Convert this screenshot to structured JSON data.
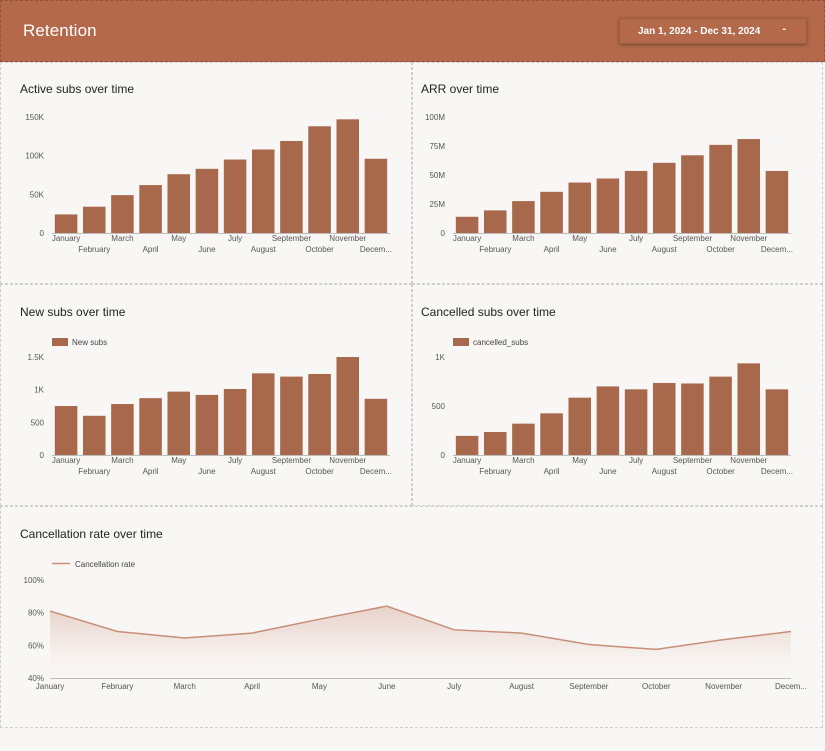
{
  "header": {
    "title": "Retention",
    "date_range": "Jan 1, 2024 - Dec 31, 2024",
    "caret": "-"
  },
  "colors": {
    "accent": "#b3694a",
    "bar": "#a8684b",
    "line": "#c98e78"
  },
  "chart_data": [
    {
      "type": "bar",
      "title": "Active subs over time",
      "categories": [
        "January",
        "February",
        "March",
        "April",
        "May",
        "June",
        "July",
        "August",
        "September",
        "October",
        "November",
        "Decem..."
      ],
      "values": [
        24000,
        34000,
        49000,
        62000,
        76000,
        83000,
        95000,
        108000,
        119000,
        138000,
        147000,
        96000
      ],
      "ylim": [
        0,
        150000
      ],
      "yticks": [
        0,
        50000,
        100000,
        150000
      ],
      "ytick_labels": [
        "0",
        "50K",
        "100K",
        "150K"
      ],
      "grid": false
    },
    {
      "type": "bar",
      "title": "ARR over time",
      "categories": [
        "January",
        "February",
        "March",
        "April",
        "May",
        "June",
        "July",
        "August",
        "September",
        "October",
        "November",
        "Decem..."
      ],
      "values": [
        14000000,
        19500000,
        27500000,
        35500000,
        43500000,
        47000000,
        53500000,
        60500000,
        67000000,
        76000000,
        81000000,
        53500000
      ],
      "ylim": [
        0,
        100000000
      ],
      "yticks": [
        0,
        25000000,
        50000000,
        75000000,
        100000000
      ],
      "ytick_labels": [
        "0",
        "25M",
        "50M",
        "75M",
        "100M"
      ],
      "grid": false
    },
    {
      "type": "bar",
      "title": "New subs over time",
      "legend": "New subs",
      "categories": [
        "January",
        "February",
        "March",
        "April",
        "May",
        "June",
        "July",
        "August",
        "September",
        "October",
        "November",
        "Decem..."
      ],
      "values": [
        750,
        600,
        780,
        870,
        970,
        920,
        1010,
        1250,
        1200,
        1240,
        1500,
        860
      ],
      "ylim": [
        0,
        1500
      ],
      "yticks": [
        0,
        500,
        1000,
        1500
      ],
      "ytick_labels": [
        "0",
        "500",
        "1K",
        "1.5K"
      ],
      "grid": false
    },
    {
      "type": "bar",
      "title": "Cancelled subs over time",
      "legend": "cancelled_subs",
      "categories": [
        "January",
        "February",
        "March",
        "April",
        "May",
        "June",
        "July",
        "August",
        "September",
        "October",
        "November",
        "Decem..."
      ],
      "values": [
        195,
        235,
        320,
        425,
        585,
        700,
        670,
        735,
        730,
        800,
        935,
        670
      ],
      "ylim": [
        0,
        1000
      ],
      "yticks": [
        0,
        500,
        1000
      ],
      "ytick_labels": [
        "0",
        "500",
        "1K"
      ],
      "grid": false
    },
    {
      "type": "area",
      "title": "Cancellation rate over time",
      "legend": "Cancellation rate",
      "categories": [
        "January",
        "February",
        "March",
        "April",
        "May",
        "June",
        "July",
        "August",
        "September",
        "October",
        "November",
        "Decem..."
      ],
      "values": [
        81,
        68.5,
        64.5,
        67.5,
        76,
        84,
        69.5,
        67.5,
        60.5,
        57.5,
        63.5,
        68.5
      ],
      "ylim": [
        40,
        100
      ],
      "yticks": [
        40,
        60,
        80,
        100
      ],
      "ytick_labels": [
        "40%",
        "60%",
        "80%",
        "100%"
      ],
      "grid": false
    }
  ]
}
